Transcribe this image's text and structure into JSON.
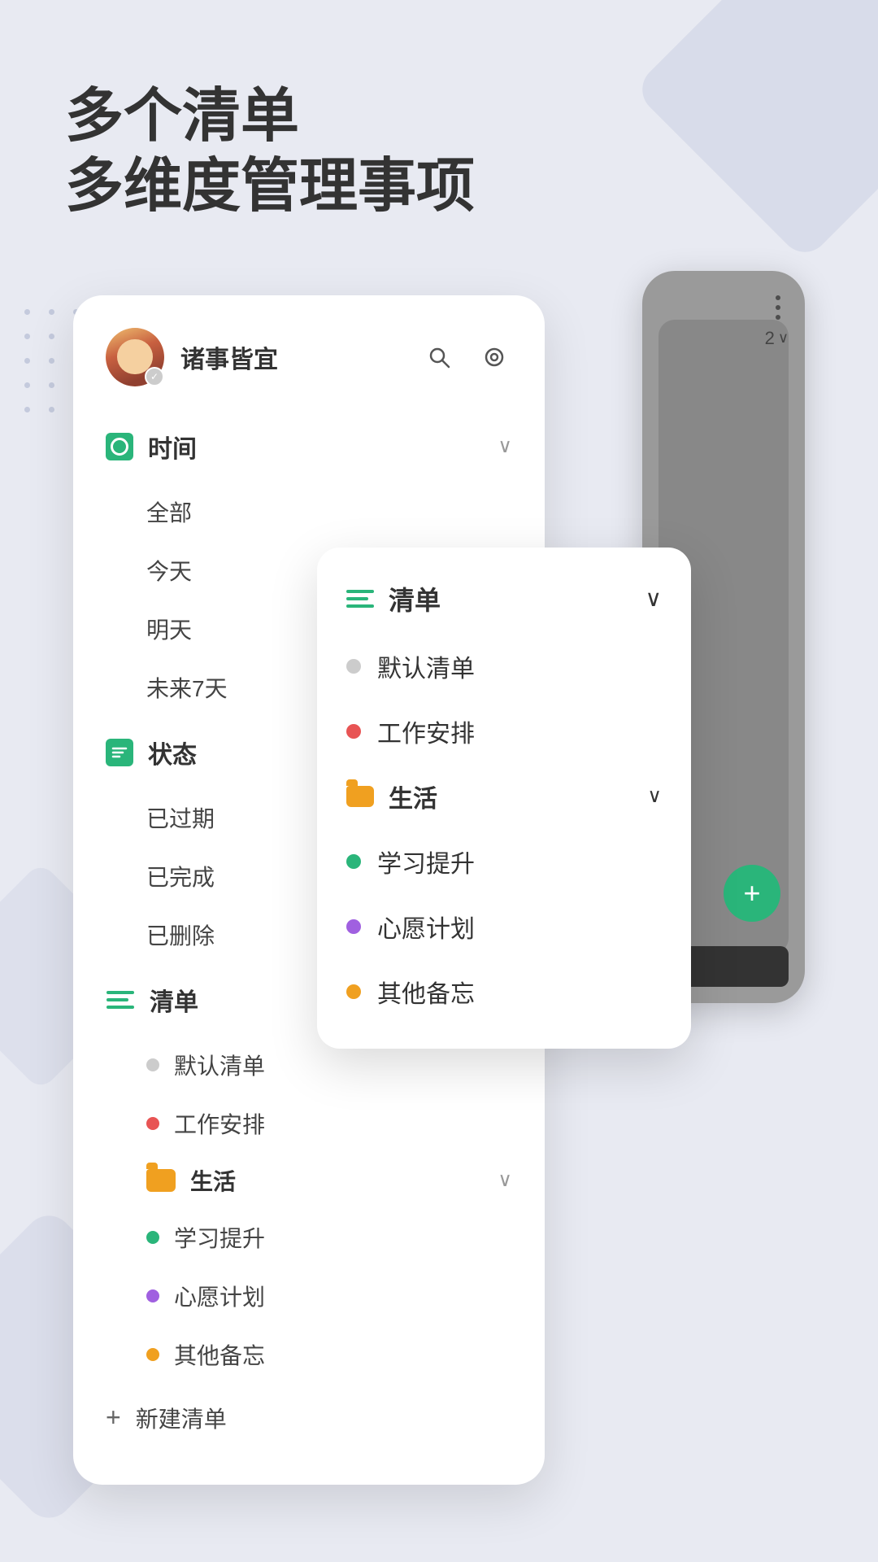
{
  "header": {
    "line1": "多个清单",
    "line2": "多维度管理事项"
  },
  "sidebar": {
    "username": "诸事皆宜",
    "search_icon": "search",
    "settings_icon": "target",
    "sections": [
      {
        "id": "time",
        "label": "时间",
        "items": [
          "全部",
          "今天",
          "明天",
          "未来7天"
        ]
      },
      {
        "id": "status",
        "label": "状态",
        "items": [
          "已过期",
          "已完成",
          "已删除"
        ]
      },
      {
        "id": "list",
        "label": "清单",
        "items": [
          {
            "name": "默认清单",
            "color": "gray"
          },
          {
            "name": "工作安排",
            "color": "red"
          }
        ],
        "groups": [
          {
            "name": "生活",
            "items": [
              {
                "name": "学习提升",
                "color": "green"
              },
              {
                "name": "心愿计划",
                "color": "purple"
              },
              {
                "name": "其他备忘",
                "color": "orange"
              }
            ]
          }
        ]
      }
    ],
    "new_list_label": "新建清单"
  },
  "dropdown": {
    "title": "清单",
    "items": [
      {
        "name": "默认清单",
        "color": "gray"
      },
      {
        "name": "工作安排",
        "color": "red"
      }
    ],
    "groups": [
      {
        "name": "生活",
        "items": [
          {
            "name": "学习提升",
            "color": "green"
          },
          {
            "name": "心愿计划",
            "color": "purple"
          },
          {
            "name": "其他备忘",
            "color": "orange"
          }
        ]
      }
    ]
  },
  "phone_back": {
    "counter": "2",
    "fab_label": "+"
  }
}
